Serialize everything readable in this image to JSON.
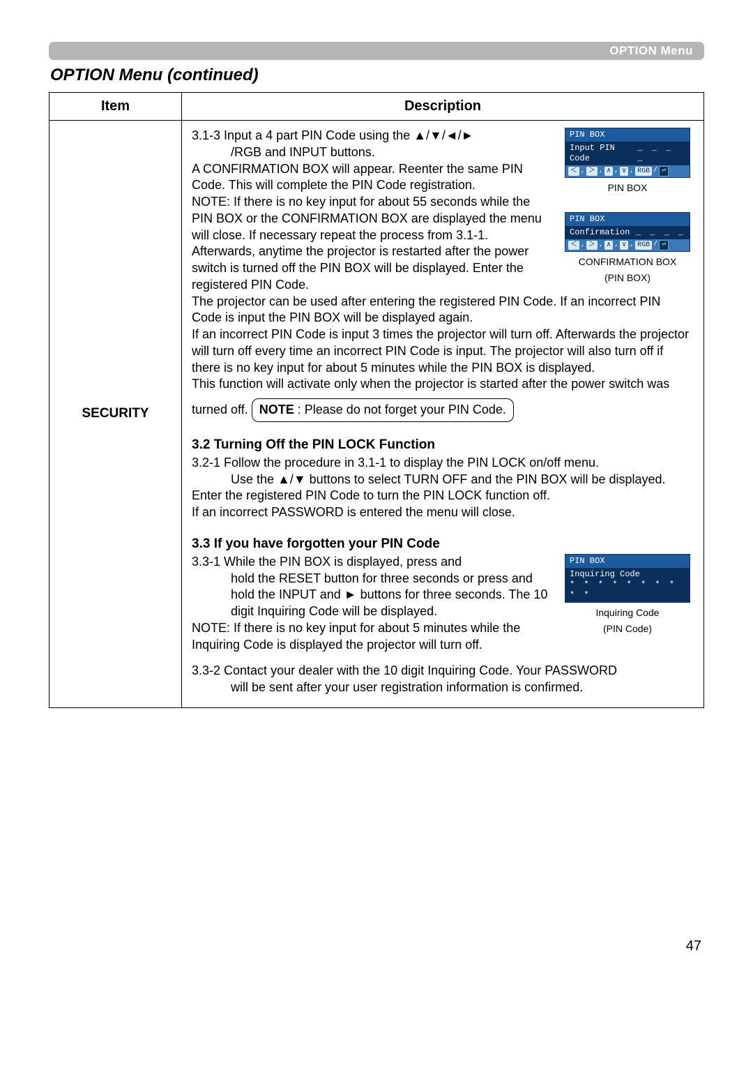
{
  "header": {
    "menu_label": "OPTION Menu"
  },
  "title": "OPTION Menu (continued)",
  "table": {
    "head": {
      "item": "Item",
      "description": "Description"
    },
    "item_label": "SECURITY"
  },
  "section_313": {
    "lead": "3.1-3  Input a 4 part PIN Code using the ▲/▼/◄/►",
    "lead2": "/RGB and INPUT buttons.",
    "p1": "A CONFIRMATION BOX will appear. Reenter the same PIN Code. This will complete the PIN Code registration.",
    "p2": "NOTE: If there is no key input for about 55 seconds while the PIN BOX or the CONFIRMATION BOX are displayed the menu will close. If necessary repeat the process from 3.1-1.",
    "p3": "Afterwards, anytime the projector is restarted after the power switch is turned off the PIN BOX will be displayed. Enter the registered PIN Code.",
    "p4": "The projector can be used after entering the registered PIN Code. If an incorrect PIN Code is input the PIN BOX will be displayed again.",
    "p5": "If an incorrect PIN Code is input 3 times the projector will turn off. Afterwards the projector will turn off every time an incorrect PIN Code is input. The projector will also turn off if there is no key input for about 5 minutes while the PIN BOX is displayed.",
    "p6": "This function will activate only when the projector is started after the power switch was turned off."
  },
  "note": {
    "label": "NOTE",
    "text": " : Please do not forget your PIN Code."
  },
  "section_32": {
    "title": "3.2 Turning Off the PIN LOCK Function",
    "p1": "3.2-1 Follow the procedure in 3.1-1 to display the PIN LOCK on/off menu.",
    "p1b": "Use the ▲/▼ buttons to select TURN OFF and the PIN BOX will be displayed.",
    "p2": "Enter the registered PIN Code to turn the PIN LOCK function off.",
    "p3": "If an incorrect PASSWORD is entered the  menu will close."
  },
  "section_33": {
    "title": "3.3 If you have forgotten your PIN Code",
    "p1": "3.3-1 While the PIN BOX is displayed, press and",
    "p1b": "hold the RESET button for three seconds or press and hold the INPUT and ► buttons for three seconds. The 10 digit Inquiring Code will be displayed.",
    "p2": "NOTE: If there is no key input for about 5 minutes while the Inquiring Code is displayed the projector will turn off.",
    "p3": "3.3-2 Contact your dealer with the 10 digit Inquiring Code. Your PASSWORD",
    "p3b": "will be sent after your user registration information is confirmed."
  },
  "diagrams": {
    "pinbox": {
      "title": "PIN BOX",
      "line": "Input PIN Code",
      "dashes": "_ _ _ _",
      "caption": "PIN BOX"
    },
    "confirm": {
      "title": "PIN BOX",
      "line": "Confirmation",
      "dashes": "_ _ _ _",
      "caption1": "CONFIRMATION BOX",
      "caption2": "(PIN BOX)"
    },
    "inquiring": {
      "title": "PIN BOX",
      "line": "Inquiring Code",
      "stars": "* *  * * * *  * * * *",
      "caption1": "Inquiring Code",
      "caption2": "(PIN Code)"
    },
    "keys": {
      "left": "＜",
      "right": "＞",
      "up": "∧",
      "down": "∨",
      "rgb": "RGB",
      "input": "⏎"
    }
  },
  "page_number": "47"
}
